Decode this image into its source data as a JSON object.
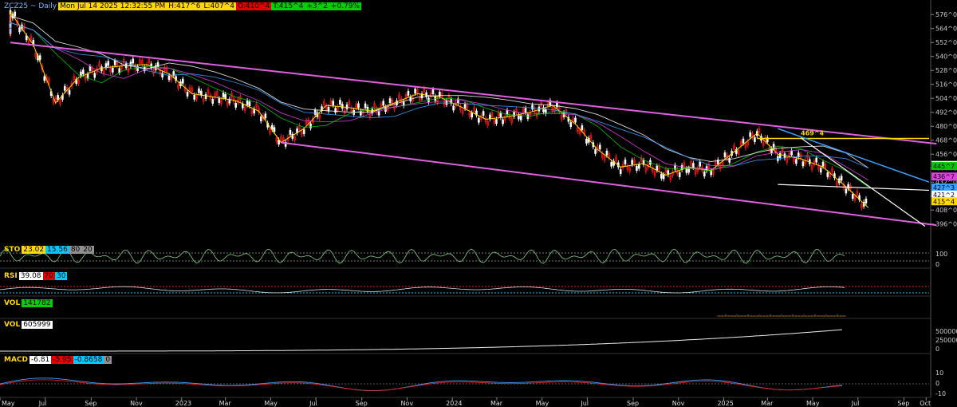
{
  "header": {
    "symbol": "ZCZ25 ~ Daily",
    "datetime": "Mon Jul 14 2025 12:32:55 PM",
    "high": "H:417^6",
    "low": "L:407^4",
    "open": "O:410^4",
    "last": "T:415^4",
    "change": "+3^2",
    "change_pct": "+0.79%"
  },
  "panels": {
    "sto": {
      "label": "STO",
      "v1": "23.02",
      "v2": "15.56",
      "v3": "80",
      "v4": "20"
    },
    "rsi": {
      "label": "RSI",
      "v1": "39.08",
      "v2": "70",
      "v3": "30"
    },
    "vol1": {
      "label": "VOL",
      "v1": "141782"
    },
    "vol2": {
      "label": "VOL",
      "v1": "605999"
    },
    "macd": {
      "label": "MACD",
      "v1": "-6.81",
      "v2": "-5.95",
      "v3": "-0.8658",
      "v4": "0"
    }
  },
  "annotation": {
    "text": "469^4"
  },
  "price_labels": [
    {
      "text": "446^6",
      "bg": "#ffffff"
    },
    {
      "text": "445^7",
      "bg": "#00c800"
    },
    {
      "text": "436^7",
      "bg": "#e040e0"
    },
    {
      "text": "427^3",
      "bg": "#3aa0ff"
    },
    {
      "text": "421^2",
      "bg": "#ffffff"
    },
    {
      "text": "415^4",
      "bg": "#ffd800"
    }
  ],
  "chart_data": {
    "type": "line",
    "title": "ZCZ25 ~ Daily",
    "x_ticks": [
      "May",
      "Jul",
      "Sep",
      "Nov",
      "2023",
      "Mar",
      "May",
      "Jul",
      "Sep",
      "Nov",
      "2024",
      "Mar",
      "May",
      "Jul",
      "Sep",
      "Nov",
      "2025",
      "Mar",
      "May",
      "Jul",
      "Sep",
      "Oct"
    ],
    "y_ticks": [
      "576^0",
      "564^0",
      "552^0",
      "540^0",
      "528^0",
      "516^0",
      "504^0",
      "492^0",
      "480^0",
      "468^0",
      "456^0",
      "444^0",
      "432^0",
      "420^0",
      "408^0",
      "396^0"
    ],
    "ylim": [
      391,
      583
    ],
    "price_series": {
      "name": "",
      "x": [
        "2022-05",
        "2022-05",
        "2022-06",
        "2022-07",
        "2022-08",
        "2022-09",
        "2022-10",
        "2022-11",
        "2022-12",
        "2023-01",
        "2023-02",
        "2023-03",
        "2023-04",
        "2023-05",
        "2023-06",
        "2023-07",
        "2023-08",
        "2023-09",
        "2023-10",
        "2023-11",
        "2023-12",
        "2024-01",
        "2024-02",
        "2024-03",
        "2024-04",
        "2024-05",
        "2024-06",
        "2024-07",
        "2024-08",
        "2024-09",
        "2024-10",
        "2024-11",
        "2024-12",
        "2025-01",
        "2025-02",
        "2025-03",
        "2025-04",
        "2025-05",
        "2025-06",
        "2025-07"
      ],
      "values": [
        560,
        578,
        550,
        500,
        522,
        530,
        532,
        533,
        525,
        508,
        505,
        502,
        493,
        466,
        478,
        498,
        496,
        493,
        500,
        508,
        505,
        496,
        486,
        488,
        492,
        498,
        482,
        460,
        445,
        448,
        438,
        445,
        442,
        458,
        474,
        456,
        452,
        445,
        428,
        410
      ]
    },
    "channel_upper": {
      "from": [
        "2022-05",
        552
      ],
      "to": [
        "2025-10",
        465
      ]
    },
    "channel_lower": {
      "from": [
        "2023-05",
        466
      ],
      "to": [
        "2025-10",
        395
      ]
    },
    "horizontal_line": {
      "value": 469.5
    },
    "panels": [
      "STO",
      "RSI",
      "VOL",
      "VOL",
      "MACD"
    ],
    "panel_scales": {
      "sto": [
        "100",
        "0"
      ],
      "vol2": [
        "500000",
        "250000",
        "0"
      ],
      "macd": [
        "10",
        "0",
        "-10"
      ]
    },
    "colors": {
      "upper_channel": "#e060e0",
      "lower_channel": "#e060e0",
      "yellow": "#ffd800",
      "blue_trend": "#3aa0ff"
    }
  }
}
